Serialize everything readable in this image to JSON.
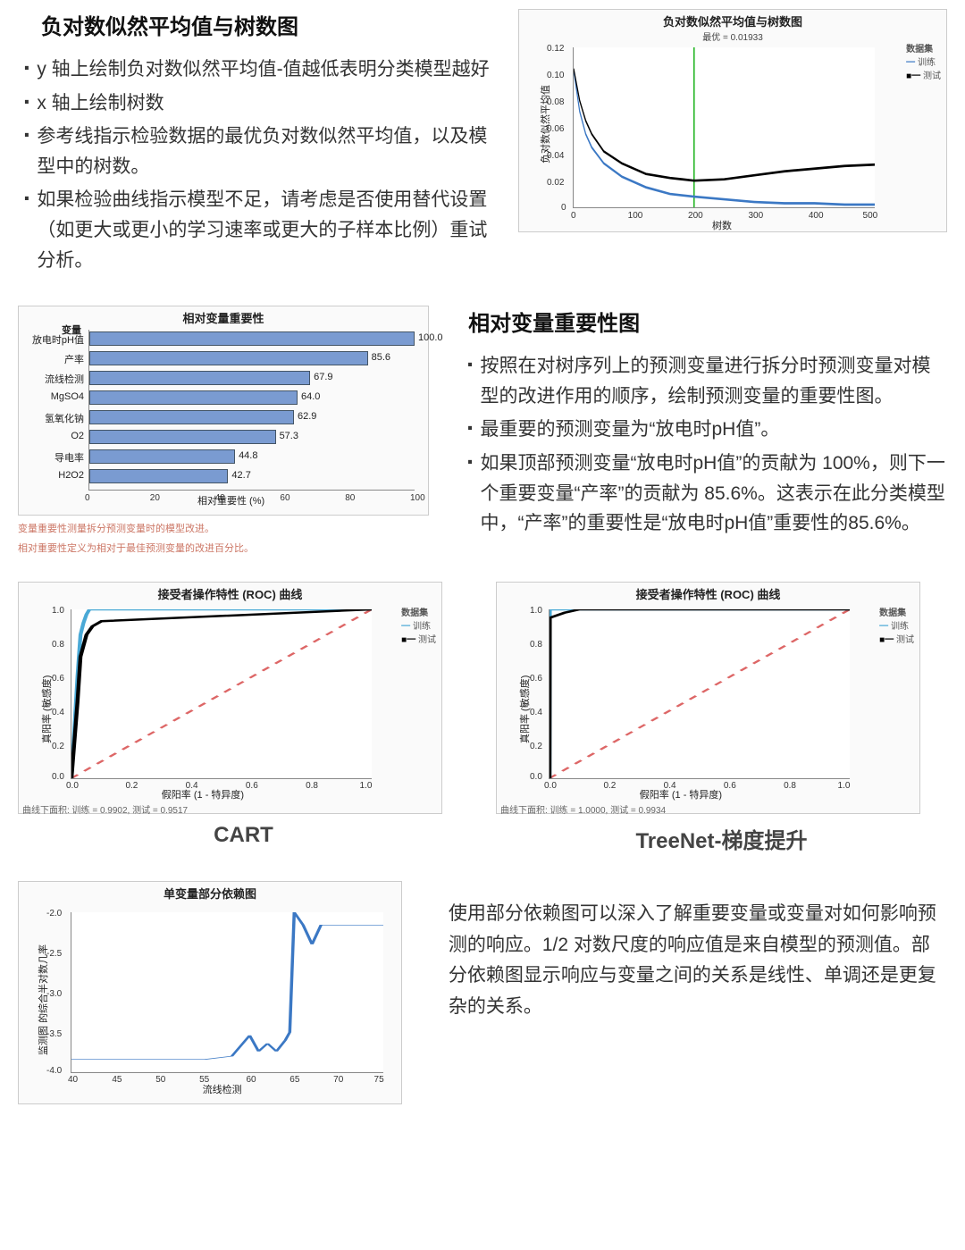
{
  "section1": {
    "title": "负对数似然平均值与树数图",
    "bullets": [
      "y 轴上绘制负对数似然平均值-值越低表明分类模型越好",
      "x 轴上绘制树数",
      "参考线指示检验数据的最优负对数似然平均值，以及模型中的树数。",
      "如果检验曲线指示模型不足，请考虑是否使用替代设置（如更大或更小的学习速率或更大的子样本比例）重试分析。"
    ]
  },
  "section2": {
    "title": "相对变量重要性图",
    "bullets": [
      "按照在对树序列上的预测变量进行拆分时预测变量对模型的改进作用的顺序，绘制预测变量的重要性图。",
      "最重要的预测变量为“放电时pH值”。",
      "如果顶部预测变量“放电时pH值”的贡献为 100%，则下一个重要变量“产率”的贡献为 85.6%。这表示在此分类模型中，“产率”的重要性是“放电时pH值”重要性的85.6%。"
    ]
  },
  "section3": {
    "cart": "CART",
    "treenet": "TreeNet-梯度提升"
  },
  "section4": {
    "text": "使用部分依赖图可以深入了解重要变量或变量对如何影响预测的响应。1/2 对数尺度的响应值是来自模型的预测值。部分依赖图显示响应与变量之间的关系是线性、单调还是更复杂的关系。"
  },
  "chart_data": [
    {
      "id": "nll_vs_trees",
      "type": "line",
      "title": "负对数似然平均值与树数图",
      "subtitle": "最优 = 0.01933",
      "xlabel": "树数",
      "ylabel": "负对数似然平均值",
      "xlim": [
        0,
        500
      ],
      "ylim": [
        0,
        0.12
      ],
      "xticks": [
        0,
        100,
        200,
        300,
        400,
        500
      ],
      "yticks": [
        0,
        0.02,
        0.04,
        0.06,
        0.08,
        0.1,
        0.12
      ],
      "legend_title": "数据集",
      "reference_x": 200,
      "series": [
        {
          "name": "训练",
          "color": "#3b78c4",
          "x": [
            0,
            10,
            20,
            30,
            50,
            80,
            120,
            160,
            200,
            250,
            300,
            350,
            400,
            450,
            500
          ],
          "y": [
            0.103,
            0.072,
            0.055,
            0.045,
            0.033,
            0.023,
            0.015,
            0.01,
            0.008,
            0.006,
            0.004,
            0.003,
            0.003,
            0.002,
            0.002
          ]
        },
        {
          "name": "测试",
          "color": "#000",
          "x": [
            0,
            10,
            20,
            30,
            50,
            80,
            120,
            160,
            200,
            250,
            300,
            350,
            400,
            450,
            500
          ],
          "y": [
            0.104,
            0.08,
            0.065,
            0.055,
            0.042,
            0.033,
            0.025,
            0.022,
            0.02,
            0.021,
            0.024,
            0.027,
            0.029,
            0.031,
            0.032
          ]
        }
      ]
    },
    {
      "id": "var_importance",
      "type": "bar",
      "orientation": "horizontal",
      "title": "相对变量重要性",
      "y_title": "变量",
      "xlabel": "相对重要性 (%)",
      "xlim": [
        0,
        100
      ],
      "xticks": [
        0,
        20,
        40,
        60,
        80,
        100
      ],
      "categories": [
        "放电时pH值",
        "产率",
        "流线检测",
        "MgSO4",
        "氢氧化钠",
        "O2",
        "导电率",
        "H2O2"
      ],
      "values": [
        100.0,
        85.6,
        67.9,
        64.0,
        62.9,
        57.3,
        44.8,
        42.7
      ],
      "footnotes": [
        "变量重要性测量拆分预测变量时的模型改进。",
        "相对重要性定义为相对于最佳预测变量的改进百分比。"
      ]
    },
    {
      "id": "roc_cart",
      "type": "line",
      "title": "接受者操作特性 (ROC) 曲线",
      "xlabel": "假阳率 (1 - 特异度)",
      "ylabel": "真阳率 (敏感度)",
      "xlim": [
        0,
        1
      ],
      "ylim": [
        0,
        1
      ],
      "ticks": [
        0.0,
        0.2,
        0.4,
        0.6,
        0.8,
        1.0
      ],
      "legend_title": "数据集",
      "auc_note": "曲线下面积: 训练 = 0.9902, 测试 = 0.9517",
      "series": [
        {
          "name": "训练",
          "color": "#4aa9d6",
          "x": [
            0,
            0.02,
            0.03,
            0.04,
            0.05,
            0.06,
            1
          ],
          "y": [
            0,
            0.6,
            0.85,
            0.92,
            0.97,
            1,
            1
          ]
        },
        {
          "name": "测试",
          "color": "#000",
          "x": [
            0,
            0.02,
            0.03,
            0.05,
            0.07,
            0.1,
            1
          ],
          "y": [
            0,
            0.45,
            0.72,
            0.85,
            0.9,
            0.93,
            1
          ]
        }
      ]
    },
    {
      "id": "roc_treenet",
      "type": "line",
      "title": "接受者操作特性 (ROC) 曲线",
      "xlabel": "假阳率 (1 - 特异度)",
      "ylabel": "真阳率 (敏感度)",
      "xlim": [
        0,
        1
      ],
      "ylim": [
        0,
        1
      ],
      "ticks": [
        0.0,
        0.2,
        0.4,
        0.6,
        0.8,
        1.0
      ],
      "legend_title": "数据集",
      "auc_note": "曲线下面积: 训练 = 1.0000, 测试 = 0.9934",
      "series": [
        {
          "name": "训练",
          "color": "#4aa9d6",
          "x": [
            0,
            0.001,
            0.1,
            1
          ],
          "y": [
            0,
            1,
            1,
            1
          ]
        },
        {
          "name": "测试",
          "color": "#000",
          "x": [
            0,
            0.001,
            0.05,
            0.1,
            1
          ],
          "y": [
            0,
            0.95,
            0.98,
            1,
            1
          ]
        }
      ]
    },
    {
      "id": "partial_dep",
      "type": "line",
      "title": "单变量部分依赖图",
      "xlabel": "流线检测",
      "ylabel": "监测图 的综合半对数几率",
      "xlim": [
        40,
        75
      ],
      "ylim": [
        -4.0,
        -2.0
      ],
      "xticks": [
        40,
        45,
        50,
        55,
        60,
        65,
        70,
        75
      ],
      "yticks": [
        -4.0,
        -3.5,
        -3.0,
        -2.5,
        -2.0
      ],
      "series": [
        {
          "name": "",
          "color": "#3b78c4",
          "x": [
            40,
            42,
            45,
            50,
            55,
            58,
            60,
            61,
            62,
            63,
            64,
            64.5,
            65,
            66,
            67,
            68,
            70,
            75
          ],
          "y": [
            -3.85,
            -3.85,
            -3.85,
            -3.85,
            -3.85,
            -3.8,
            -3.55,
            -3.75,
            -3.65,
            -3.75,
            -3.6,
            -3.5,
            -2.0,
            -2.15,
            -2.4,
            -2.15,
            -2.15,
            -2.15
          ]
        }
      ]
    }
  ]
}
